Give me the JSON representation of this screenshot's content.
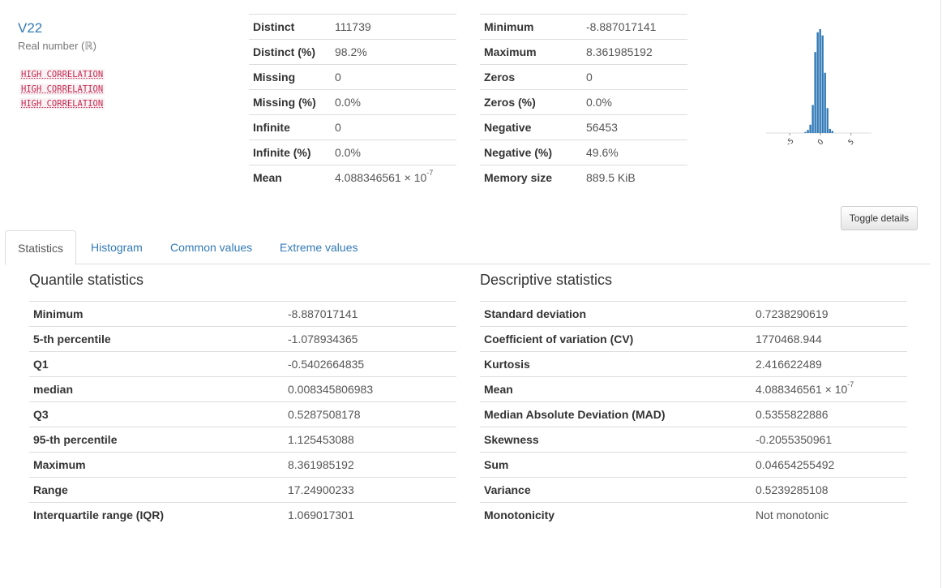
{
  "variable": {
    "name": "V22",
    "type": "Real number (ℝ)",
    "warnings": [
      "HIGH CORRELATION",
      "HIGH CORRELATION",
      "HIGH CORRELATION"
    ]
  },
  "overview_left": [
    {
      "label": "Distinct",
      "value": "111739"
    },
    {
      "label": "Distinct (%)",
      "value": "98.2%"
    },
    {
      "label": "Missing",
      "value": "0"
    },
    {
      "label": "Missing (%)",
      "value": "0.0%"
    },
    {
      "label": "Infinite",
      "value": "0"
    },
    {
      "label": "Infinite (%)",
      "value": "0.0%"
    },
    {
      "label": "Mean",
      "value": "4.088346561 × 10",
      "exponent": "-7"
    }
  ],
  "overview_right": [
    {
      "label": "Minimum",
      "value": "-8.887017141"
    },
    {
      "label": "Maximum",
      "value": "8.361985192"
    },
    {
      "label": "Zeros",
      "value": "0"
    },
    {
      "label": "Zeros (%)",
      "value": "0.0%"
    },
    {
      "label": "Negative",
      "value": "56453"
    },
    {
      "label": "Negative (%)",
      "value": "49.6%"
    },
    {
      "label": "Memory size",
      "value": "889.5 KiB"
    }
  ],
  "mini_histogram": {
    "tick_labels": [
      "-5",
      "0",
      "5"
    ],
    "tick_values": [
      -5,
      0,
      5
    ],
    "x_range": [
      -8.887,
      8.362
    ],
    "bar_color": "#337ab7",
    "bins": [
      {
        "x": -2.4,
        "h": 0.01
      },
      {
        "x": -2.0,
        "h": 0.03
      },
      {
        "x": -1.6,
        "h": 0.08
      },
      {
        "x": -1.2,
        "h": 0.27
      },
      {
        "x": -0.8,
        "h": 0.78
      },
      {
        "x": -0.4,
        "h": 0.97
      },
      {
        "x": 0.0,
        "h": 1.0
      },
      {
        "x": 0.4,
        "h": 0.94
      },
      {
        "x": 0.8,
        "h": 0.58
      },
      {
        "x": 1.2,
        "h": 0.24
      },
      {
        "x": 1.6,
        "h": 0.04
      },
      {
        "x": 2.0,
        "h": 0.02
      }
    ]
  },
  "toggle_label": "Toggle details",
  "tabs": [
    "Statistics",
    "Histogram",
    "Common values",
    "Extreme values"
  ],
  "quantile": {
    "title": "Quantile statistics",
    "rows": [
      {
        "label": "Minimum",
        "value": "-8.887017141"
      },
      {
        "label": "5-th percentile",
        "value": "-1.078934365"
      },
      {
        "label": "Q1",
        "value": "-0.5402664835"
      },
      {
        "label": "median",
        "value": "0.008345806983"
      },
      {
        "label": "Q3",
        "value": "0.5287508178"
      },
      {
        "label": "95-th percentile",
        "value": "1.125453088"
      },
      {
        "label": "Maximum",
        "value": "8.361985192"
      },
      {
        "label": "Range",
        "value": "17.24900233"
      },
      {
        "label": "Interquartile range (IQR)",
        "value": "1.069017301"
      }
    ]
  },
  "descriptive": {
    "title": "Descriptive statistics",
    "rows": [
      {
        "label": "Standard deviation",
        "value": "0.7238290619"
      },
      {
        "label": "Coefficient of variation (CV)",
        "value": "1770468.944"
      },
      {
        "label": "Kurtosis",
        "value": "2.416622489"
      },
      {
        "label": "Mean",
        "value": "4.088346561 × 10",
        "exponent": "-7"
      },
      {
        "label": "Median Absolute Deviation (MAD)",
        "value": "0.5355822886"
      },
      {
        "label": "Skewness",
        "value": "-0.2055350961"
      },
      {
        "label": "Sum",
        "value": "0.04654255492"
      },
      {
        "label": "Variance",
        "value": "0.5239285108"
      },
      {
        "label": "Monotonicity",
        "value": "Not monotonic"
      }
    ]
  }
}
